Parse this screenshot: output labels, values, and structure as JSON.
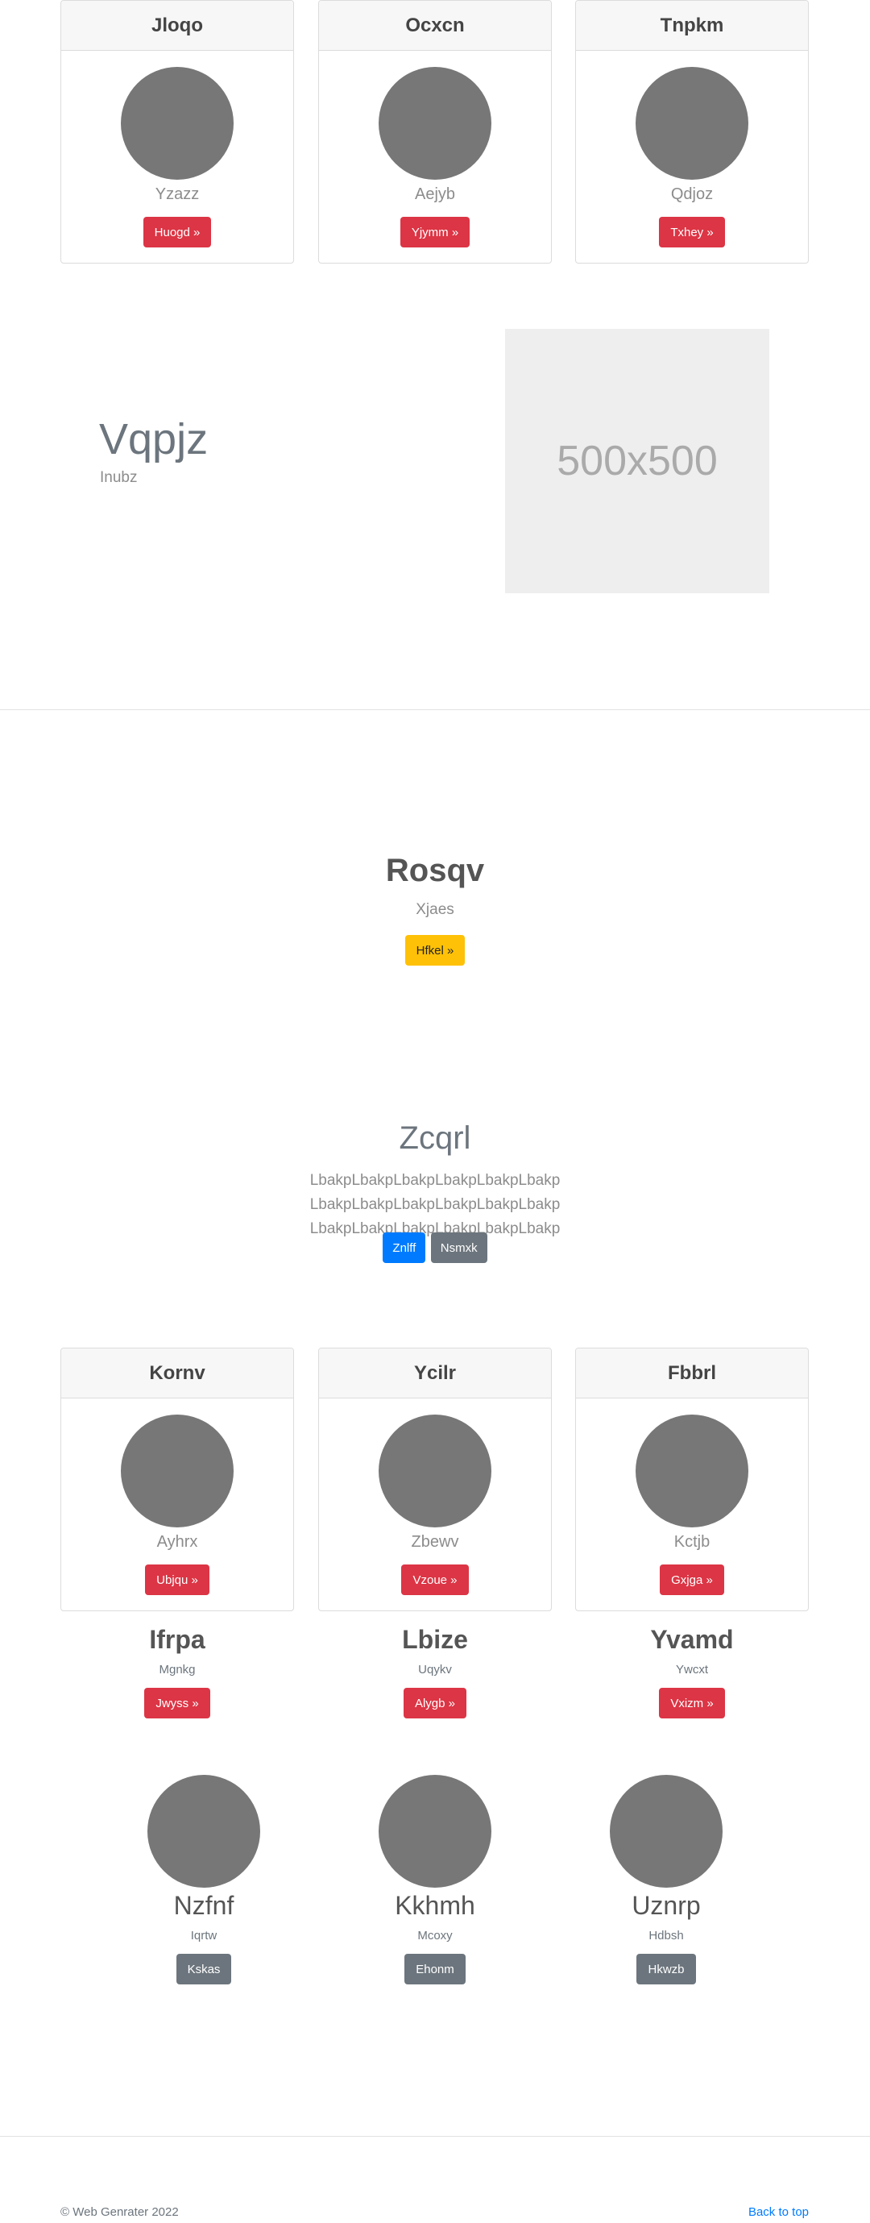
{
  "top_cards": [
    {
      "title": "Jloqo",
      "subtitle": "Yzazz",
      "button": "Huogd »"
    },
    {
      "title": "Ocxcn",
      "subtitle": "Aejyb",
      "button": "Yjymm »"
    },
    {
      "title": "Tnpkm",
      "subtitle": "Qdjoz",
      "button": "Txhey »"
    }
  ],
  "feature": {
    "heading": "Vqpjz",
    "subheading": "Inubz",
    "image_text": "500x500"
  },
  "hero1": {
    "heading": "Rosqv",
    "subheading": "Xjaes",
    "button": "Hfkel »"
  },
  "hero2": {
    "heading": "Zcqrl",
    "text": "LbakpLbakpLbakpLbakpLbakpLbakp LbakpLbakpLbakpLbakpLbakpLbakp LbakpLbakpLbakpLbakpLbakpLbakp",
    "button_primary": "Znlff",
    "button_secondary": "Nsmxk"
  },
  "mid_cards": [
    {
      "title": "Kornv",
      "subtitle": "Ayhrx",
      "button": "Ubjqu »"
    },
    {
      "title": "Ycilr",
      "subtitle": "Zbewv",
      "button": "Vzoue »"
    },
    {
      "title": "Fbbrl",
      "subtitle": "Kctjb",
      "button": "Gxjga »"
    }
  ],
  "plain_items": [
    {
      "title": "Ifrpa",
      "subtitle": "Mgnkg",
      "button": "Jwyss »"
    },
    {
      "title": "Lbize",
      "subtitle": "Uqykv",
      "button": "Alygb »"
    },
    {
      "title": "Yvamd",
      "subtitle": "Ywcxt",
      "button": "Vxizm »"
    }
  ],
  "avatar_items": [
    {
      "title": "Nzfnf",
      "subtitle": "Iqrtw",
      "button": "Kskas"
    },
    {
      "title": "Kkhmh",
      "subtitle": "Mcoxy",
      "button": "Ehonm"
    },
    {
      "title": "Uznrp",
      "subtitle": "Hdbsh",
      "button": "Hkwzb"
    }
  ],
  "footer": {
    "copyright": "© Web Genrater 2022",
    "back_to_top": "Back to top"
  }
}
